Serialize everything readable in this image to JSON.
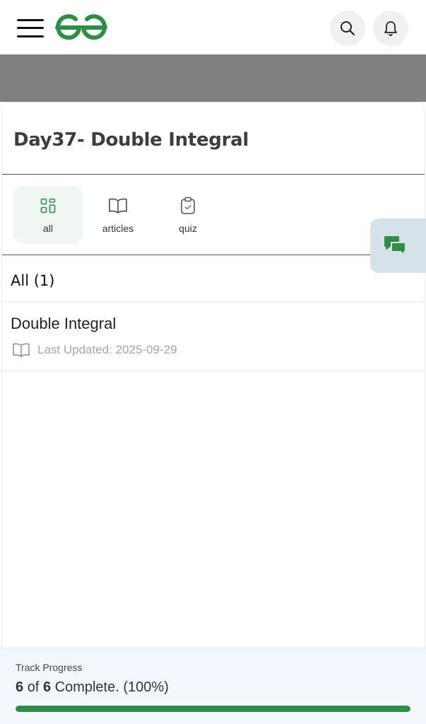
{
  "header": {
    "menu_icon": "hamburger-menu-icon",
    "logo_icon": "gfg-logo",
    "search_icon": "search-icon",
    "notification_icon": "bell-icon",
    "brand_color": "#2f8d46"
  },
  "course": {
    "title": "Day37- Double Integral"
  },
  "tabs": [
    {
      "label": "all",
      "icon": "grid-icon",
      "active": true
    },
    {
      "label": "articles",
      "icon": "book-open-icon",
      "active": false
    },
    {
      "label": "quiz",
      "icon": "clipboard-check-icon",
      "active": false
    }
  ],
  "section": {
    "heading": "All (1)"
  },
  "items": [
    {
      "title": "Double Integral",
      "icon": "book-open-icon",
      "updated": "Last Updated: 2025-09-29"
    }
  ],
  "chat": {
    "icon": "chat-bubbles-icon"
  },
  "progress": {
    "label": "Track Progress",
    "completed": "6",
    "of_word": "of",
    "total": "6",
    "complete_text": "Complete. (100%)",
    "fraction": 1.0
  }
}
